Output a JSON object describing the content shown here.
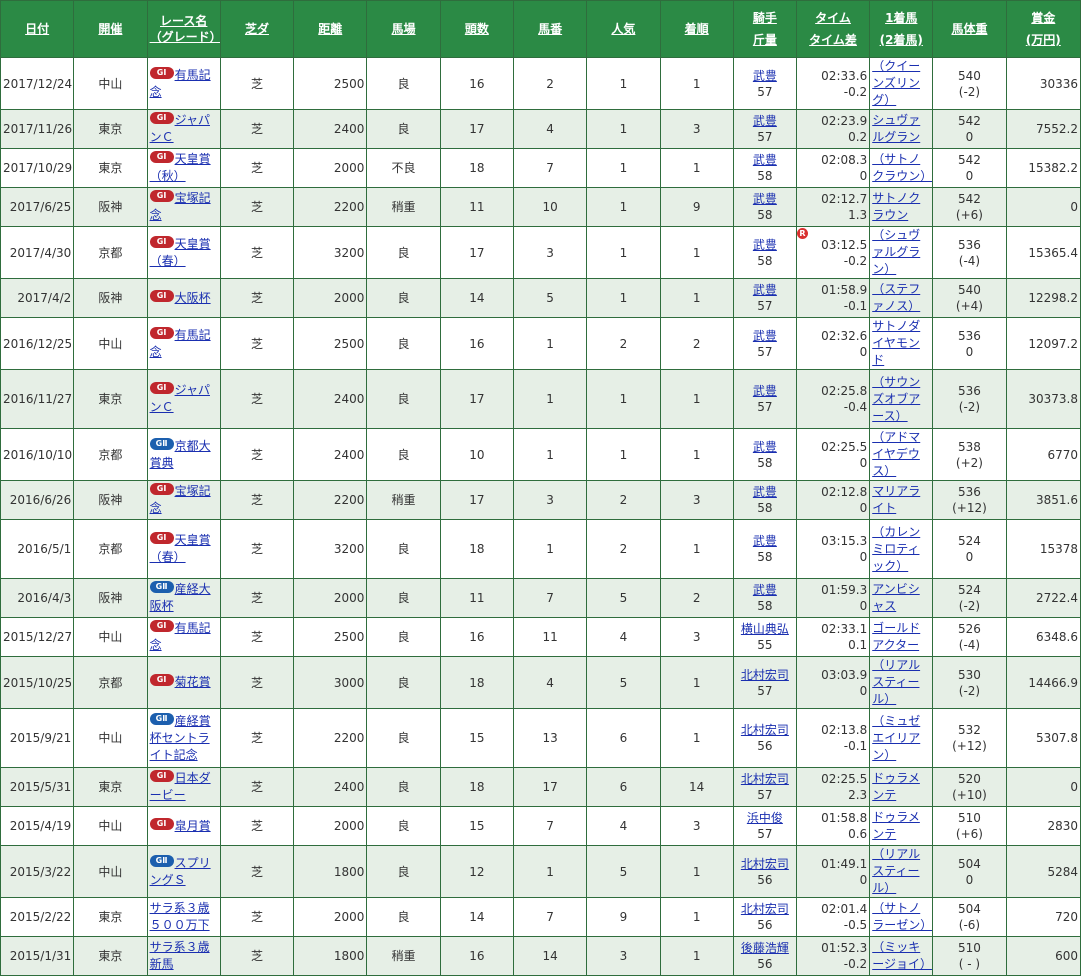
{
  "headers": {
    "date": "日付",
    "venue": "開催",
    "race_line1": "レース名",
    "race_line2": "（グレード）",
    "surface": "芝ダ",
    "distance": "距離",
    "track": "馬場",
    "runners": "頭数",
    "horse_no": "馬番",
    "popularity": "人気",
    "finish": "着順",
    "jockey_line1": "騎手",
    "jockey_line2": "斤量",
    "time_line1": "タイム",
    "time_line2": "タイム差",
    "winner_line1": "1着馬",
    "winner_line2": "(2着馬)",
    "weight": "馬体重",
    "prize_line1": "賞金",
    "prize_line2": "(万円)"
  },
  "rows": [
    {
      "date": "2017/12/24",
      "venue": "中山",
      "grade": "GⅠ",
      "race": "有馬記念",
      "surface": "芝",
      "distance": "2500",
      "track": "良",
      "runners": "16",
      "horse_no": "2",
      "popularity": "1",
      "finish": "1",
      "jockey": "武豊",
      "weight": "57",
      "time": "02:33.6",
      "diff": "-0.2",
      "winner": "（クイーンズリング）",
      "body_weight": "540",
      "body_change": "(-2)",
      "prize": "30336"
    },
    {
      "date": "2017/11/26",
      "venue": "東京",
      "grade": "GⅠ",
      "race": "ジャパンＣ",
      "surface": "芝",
      "distance": "2400",
      "track": "良",
      "runners": "17",
      "horse_no": "4",
      "popularity": "1",
      "finish": "3",
      "jockey": "武豊",
      "weight": "57",
      "time": "02:23.9",
      "diff": "0.2",
      "winner": "シュヴァルグラン",
      "body_weight": "542",
      "body_change": "0",
      "prize": "7552.2"
    },
    {
      "date": "2017/10/29",
      "venue": "東京",
      "grade": "GⅠ",
      "race": "天皇賞（秋）",
      "surface": "芝",
      "distance": "2000",
      "track": "不良",
      "runners": "18",
      "horse_no": "7",
      "popularity": "1",
      "finish": "1",
      "jockey": "武豊",
      "weight": "58",
      "time": "02:08.3",
      "diff": "0",
      "winner": "（サトノクラウン）",
      "body_weight": "542",
      "body_change": "0",
      "prize": "15382.2"
    },
    {
      "date": "2017/6/25",
      "venue": "阪神",
      "grade": "GⅠ",
      "race": "宝塚記念",
      "surface": "芝",
      "distance": "2200",
      "track": "稍重",
      "runners": "11",
      "horse_no": "10",
      "popularity": "1",
      "finish": "9",
      "jockey": "武豊",
      "weight": "58",
      "time": "02:12.7",
      "diff": "1.3",
      "winner": "サトノクラウン",
      "body_weight": "542",
      "body_change": "(+6)",
      "prize": "0"
    },
    {
      "date": "2017/4/30",
      "venue": "京都",
      "grade": "GⅠ",
      "race": "天皇賞（春）",
      "surface": "芝",
      "distance": "3200",
      "track": "良",
      "runners": "17",
      "horse_no": "3",
      "popularity": "1",
      "finish": "1",
      "jockey": "武豊",
      "weight": "58",
      "time": "03:12.5",
      "diff": "-0.2",
      "winner": "（シュヴァルグラン）",
      "body_weight": "536",
      "body_change": "(-4)",
      "prize": "15365.4",
      "record": "R"
    },
    {
      "date": "2017/4/2",
      "venue": "阪神",
      "grade": "GⅠ",
      "race": "大阪杯",
      "surface": "芝",
      "distance": "2000",
      "track": "良",
      "runners": "14",
      "horse_no": "5",
      "popularity": "1",
      "finish": "1",
      "jockey": "武豊",
      "weight": "57",
      "time": "01:58.9",
      "diff": "-0.1",
      "winner": "（ステファノス）",
      "body_weight": "540",
      "body_change": "(+4)",
      "prize": "12298.2"
    },
    {
      "date": "2016/12/25",
      "venue": "中山",
      "grade": "GⅠ",
      "race": "有馬記念",
      "surface": "芝",
      "distance": "2500",
      "track": "良",
      "runners": "16",
      "horse_no": "1",
      "popularity": "2",
      "finish": "2",
      "jockey": "武豊",
      "weight": "57",
      "time": "02:32.6",
      "diff": "0",
      "winner": "サトノダイヤモンド",
      "body_weight": "536",
      "body_change": "0",
      "prize": "12097.2"
    },
    {
      "date": "2016/11/27",
      "venue": "東京",
      "grade": "GⅠ",
      "race": "ジャパンＣ",
      "surface": "芝",
      "distance": "2400",
      "track": "良",
      "runners": "17",
      "horse_no": "1",
      "popularity": "1",
      "finish": "1",
      "jockey": "武豊",
      "weight": "57",
      "time": "02:25.8",
      "diff": "-0.4",
      "winner": "（サウンズオブアース）",
      "body_weight": "536",
      "body_change": "(-2)",
      "prize": "30373.8"
    },
    {
      "date": "2016/10/10",
      "venue": "京都",
      "grade": "GⅡ",
      "race": "京都大賞典",
      "surface": "芝",
      "distance": "2400",
      "track": "良",
      "runners": "10",
      "horse_no": "1",
      "popularity": "1",
      "finish": "1",
      "jockey": "武豊",
      "weight": "58",
      "time": "02:25.5",
      "diff": "0",
      "winner": "（アドマイヤデウス）",
      "body_weight": "538",
      "body_change": "(+2)",
      "prize": "6770"
    },
    {
      "date": "2016/6/26",
      "venue": "阪神",
      "grade": "GⅠ",
      "race": "宝塚記念",
      "surface": "芝",
      "distance": "2200",
      "track": "稍重",
      "runners": "17",
      "horse_no": "3",
      "popularity": "2",
      "finish": "3",
      "jockey": "武豊",
      "weight": "58",
      "time": "02:12.8",
      "diff": "0",
      "winner": "マリアライト",
      "body_weight": "536",
      "body_change": "(+12)",
      "prize": "3851.6"
    },
    {
      "date": "2016/5/1",
      "venue": "京都",
      "grade": "GⅠ",
      "race": "天皇賞（春）",
      "surface": "芝",
      "distance": "3200",
      "track": "良",
      "runners": "18",
      "horse_no": "1",
      "popularity": "2",
      "finish": "1",
      "jockey": "武豊",
      "weight": "58",
      "time": "03:15.3",
      "diff": "0",
      "winner": "（カレンミロティック）",
      "body_weight": "524",
      "body_change": "0",
      "prize": "15378"
    },
    {
      "date": "2016/4/3",
      "venue": "阪神",
      "grade": "GⅡ",
      "race": "産経大阪杯",
      "surface": "芝",
      "distance": "2000",
      "track": "良",
      "runners": "11",
      "horse_no": "7",
      "popularity": "5",
      "finish": "2",
      "jockey": "武豊",
      "weight": "58",
      "time": "01:59.3",
      "diff": "0",
      "winner": "アンビシャス",
      "body_weight": "524",
      "body_change": "(-2)",
      "prize": "2722.4"
    },
    {
      "date": "2015/12/27",
      "venue": "中山",
      "grade": "GⅠ",
      "race": "有馬記念",
      "surface": "芝",
      "distance": "2500",
      "track": "良",
      "runners": "16",
      "horse_no": "11",
      "popularity": "4",
      "finish": "3",
      "jockey": "横山典弘",
      "weight": "55",
      "time": "02:33.1",
      "diff": "0.1",
      "winner": "ゴールドアクター",
      "body_weight": "526",
      "body_change": "(-4)",
      "prize": "6348.6"
    },
    {
      "date": "2015/10/25",
      "venue": "京都",
      "grade": "GⅠ",
      "race": "菊花賞",
      "surface": "芝",
      "distance": "3000",
      "track": "良",
      "runners": "18",
      "horse_no": "4",
      "popularity": "5",
      "finish": "1",
      "jockey": "北村宏司",
      "weight": "57",
      "time": "03:03.9",
      "diff": "0",
      "winner": "（リアルスティール）",
      "body_weight": "530",
      "body_change": "(-2)",
      "prize": "14466.9"
    },
    {
      "date": "2015/9/21",
      "venue": "中山",
      "grade": "GⅡ",
      "race": "産経賞杯セントライト記念",
      "surface": "芝",
      "distance": "2200",
      "track": "良",
      "runners": "15",
      "horse_no": "13",
      "popularity": "6",
      "finish": "1",
      "jockey": "北村宏司",
      "weight": "56",
      "time": "02:13.8",
      "diff": "-0.1",
      "winner": "（ミュゼエイリアン）",
      "body_weight": "532",
      "body_change": "(+12)",
      "prize": "5307.8"
    },
    {
      "date": "2015/5/31",
      "venue": "東京",
      "grade": "GⅠ",
      "race": "日本ダービー",
      "surface": "芝",
      "distance": "2400",
      "track": "良",
      "runners": "18",
      "horse_no": "17",
      "popularity": "6",
      "finish": "14",
      "jockey": "北村宏司",
      "weight": "57",
      "time": "02:25.5",
      "diff": "2.3",
      "winner": "ドゥラメンテ",
      "body_weight": "520",
      "body_change": "(+10)",
      "prize": "0"
    },
    {
      "date": "2015/4/19",
      "venue": "中山",
      "grade": "GⅠ",
      "race": "皐月賞",
      "surface": "芝",
      "distance": "2000",
      "track": "良",
      "runners": "15",
      "horse_no": "7",
      "popularity": "4",
      "finish": "3",
      "jockey": "浜中俊",
      "weight": "57",
      "time": "01:58.8",
      "diff": "0.6",
      "winner": "ドゥラメンテ",
      "body_weight": "510",
      "body_change": "(+6)",
      "prize": "2830"
    },
    {
      "date": "2015/3/22",
      "venue": "中山",
      "grade": "GⅡ",
      "race": "スプリングＳ",
      "surface": "芝",
      "distance": "1800",
      "track": "良",
      "runners": "12",
      "horse_no": "1",
      "popularity": "5",
      "finish": "1",
      "jockey": "北村宏司",
      "weight": "56",
      "time": "01:49.1",
      "diff": "0",
      "winner": "（リアルスティール）",
      "body_weight": "504",
      "body_change": "0",
      "prize": "5284"
    },
    {
      "date": "2015/2/22",
      "venue": "東京",
      "grade": "",
      "race": "サラ系３歳５００万下",
      "surface": "芝",
      "distance": "2000",
      "track": "良",
      "runners": "14",
      "horse_no": "7",
      "popularity": "9",
      "finish": "1",
      "jockey": "北村宏司",
      "weight": "56",
      "time": "02:01.4",
      "diff": "-0.5",
      "winner": "（サトノラーゼン）",
      "body_weight": "504",
      "body_change": "(-6)",
      "prize": "720"
    },
    {
      "date": "2015/1/31",
      "venue": "東京",
      "grade": "",
      "race": "サラ系３歳新馬",
      "surface": "芝",
      "distance": "1800",
      "track": "稍重",
      "runners": "16",
      "horse_no": "14",
      "popularity": "3",
      "finish": "1",
      "jockey": "後藤浩輝",
      "weight": "56",
      "time": "01:52.3",
      "diff": "-0.2",
      "winner": "（ミッキージョイ）",
      "body_weight": "510",
      "body_change": "( - )",
      "prize": "600"
    }
  ]
}
